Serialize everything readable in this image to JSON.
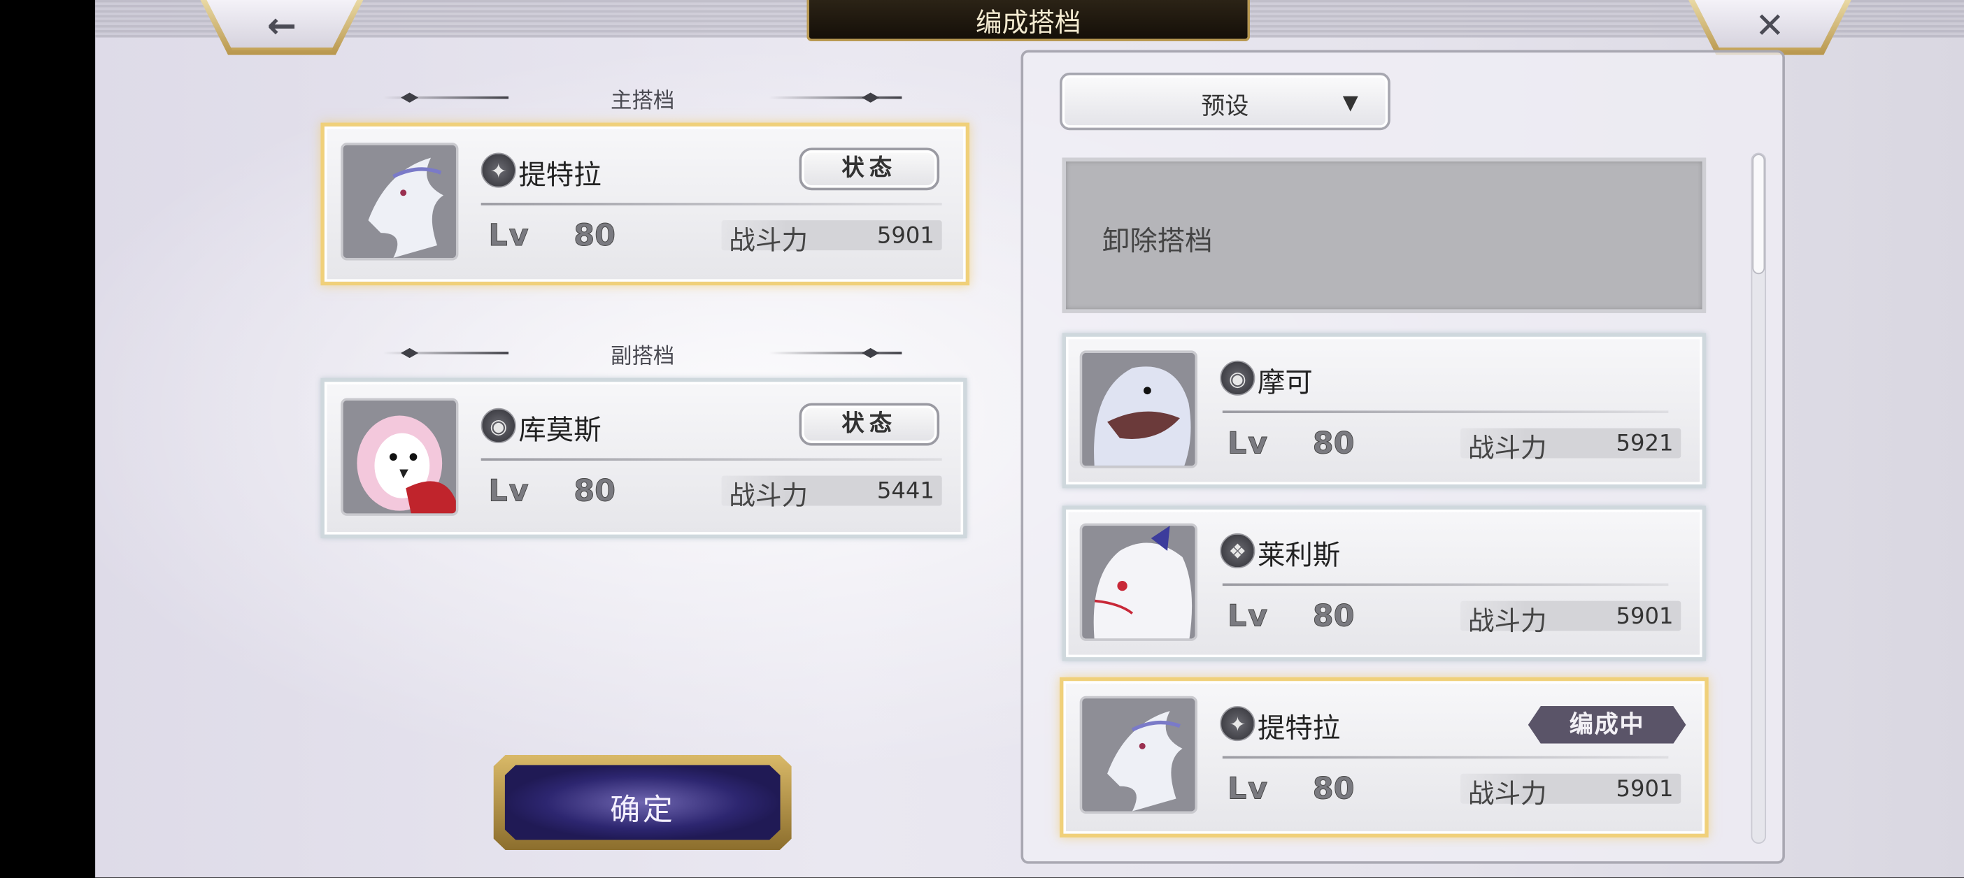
{
  "header": {
    "title": "编成搭档",
    "back_icon": "←",
    "close_icon": "✕"
  },
  "left": {
    "main_label": "主搭档",
    "sub_label": "副搭档",
    "main_partner": {
      "name": "提特拉",
      "lv_label": "Lv",
      "level": "80",
      "power_label": "战斗力",
      "power": "5901",
      "status_label": "状态",
      "attr_icon": "✦"
    },
    "sub_partner": {
      "name": "库莫斯",
      "lv_label": "Lv",
      "level": "80",
      "power_label": "战斗力",
      "power": "5441",
      "status_label": "状态",
      "attr_icon": "◉"
    },
    "confirm_label": "确定"
  },
  "right": {
    "preset_label": "预设",
    "dropdown_icon": "▼",
    "unequip_label": "卸除搭档",
    "list": [
      {
        "name": "摩可",
        "lv_label": "Lv",
        "level": "80",
        "power_label": "战斗力",
        "power": "5921",
        "attr_icon": "◉"
      },
      {
        "name": "莱利斯",
        "lv_label": "Lv",
        "level": "80",
        "power_label": "战斗力",
        "power": "5901",
        "attr_icon": "❖"
      },
      {
        "name": "提特拉",
        "lv_label": "Lv",
        "level": "80",
        "power_label": "战斗力",
        "power": "5901",
        "attr_icon": "✦",
        "badge": "编成中"
      }
    ]
  },
  "colors": {
    "gold_border": "#f0d07a",
    "badge_bg": "#5a5468",
    "confirm_bg": "#2d2670"
  }
}
